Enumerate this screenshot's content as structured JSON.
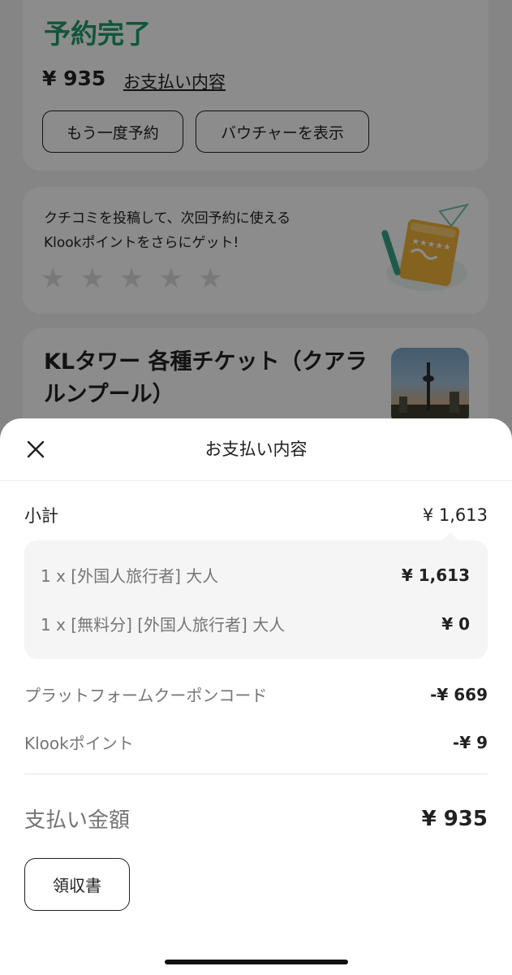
{
  "background": {
    "booking": {
      "status": "予約完了",
      "price": "¥ 935",
      "details_link": "お支払い内容",
      "rebook_label": "もう一度予約",
      "voucher_label": "バウチャーを表示"
    },
    "review": {
      "prompt_line1": "クチコミを投稿して、次回予約に使える",
      "prompt_line2": "Klookポイントをさらにゲット!",
      "stars": [
        "★",
        "★",
        "★",
        "★",
        "★"
      ]
    },
    "product": {
      "title": "KLタワー 各種チケット（クアラルンプール）"
    }
  },
  "sheet": {
    "title": "お支払い内容",
    "subtotal": {
      "label": "小計",
      "amount": "¥ 1,613"
    },
    "breakdown": [
      {
        "label": "1 x [外国人旅行者] 大人",
        "amount": "¥ 1,613"
      },
      {
        "label": "1 x [無料分] [外国人旅行者] 大人",
        "amount": "¥ 0"
      }
    ],
    "coupon": {
      "label": "プラットフォームクーポンコード",
      "amount": "-¥ 669"
    },
    "points": {
      "label": "Klookポイント",
      "amount": "-¥ 9"
    },
    "total": {
      "label": "支払い金額",
      "amount": "¥ 935"
    },
    "receipt_label": "領収書"
  },
  "colors": {
    "accent_green": "#1f9d6b",
    "overlay": "rgba(0,0,0,0.45)"
  }
}
